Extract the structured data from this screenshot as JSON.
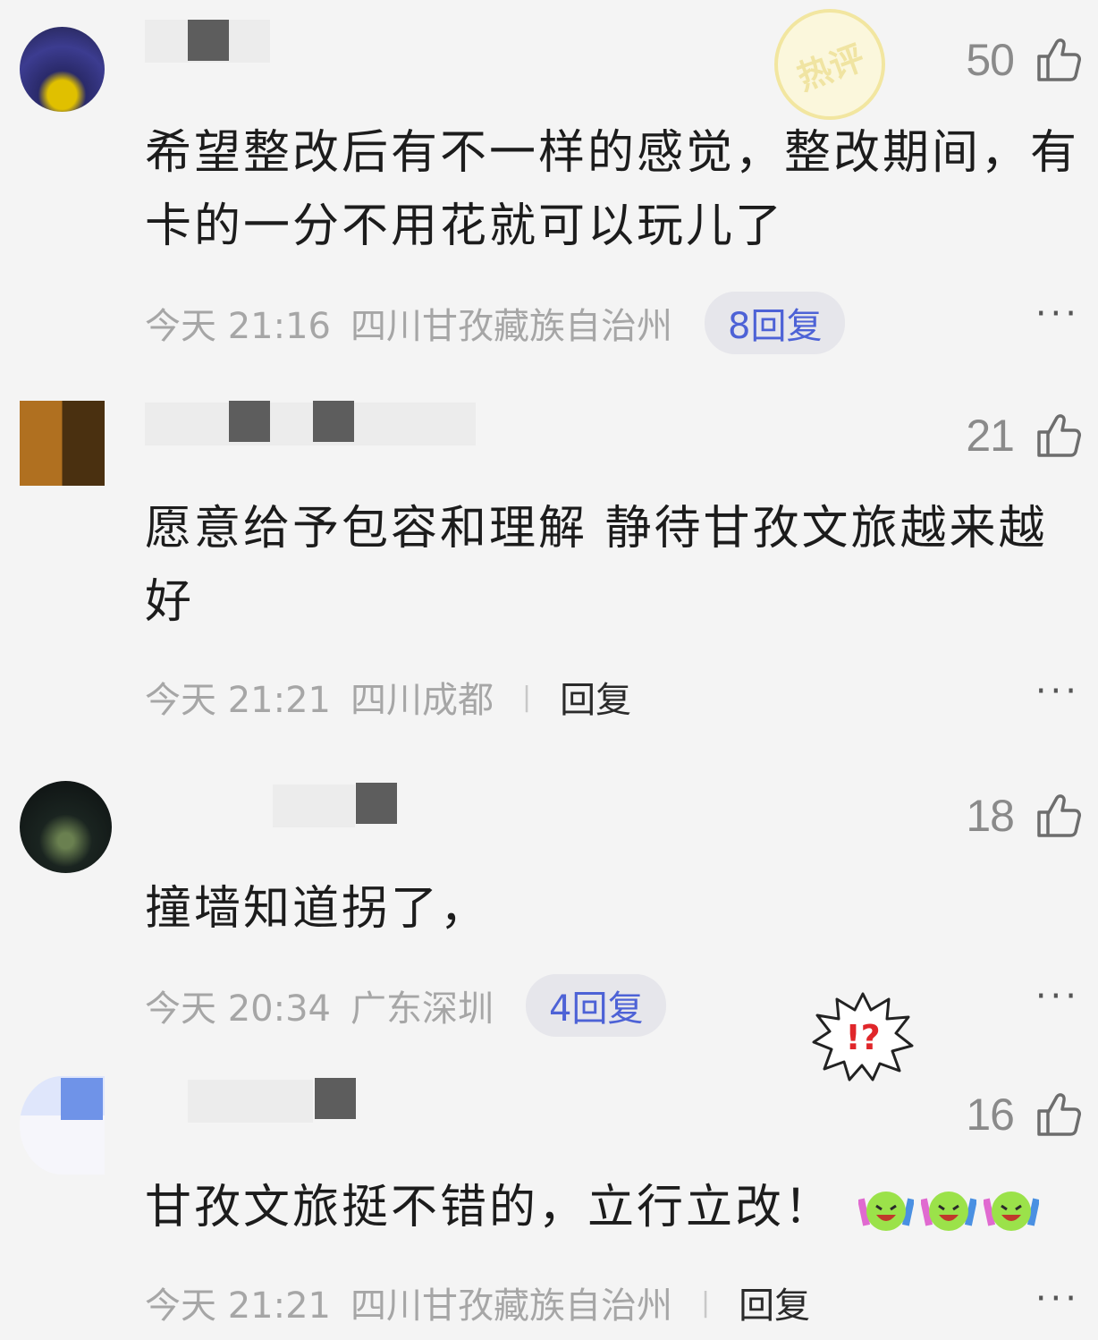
{
  "comments": [
    {
      "likes": "50",
      "text_lines": [
        "希望整改后有不一样的感觉，整改期间，有",
        "卡的一分不用花就可以玩儿了"
      ],
      "time": "今天 21:16",
      "location": "四川甘孜藏族自治州",
      "reply": "8回复",
      "badge": "热评",
      "more": "···"
    },
    {
      "likes": "21",
      "text_lines": [
        "愿意给予包容和理解 静待甘孜文旅越来越",
        "好"
      ],
      "time": "今天 21:21",
      "location": "四川成都",
      "reply": "回复",
      "more": "···"
    },
    {
      "likes": "18",
      "text_lines": [
        "撞墙知道拐了，"
      ],
      "time": "今天 20:34",
      "location": "广东深圳",
      "reply": "4回复",
      "more": "···"
    },
    {
      "likes": "16",
      "text_lines": [
        "甘孜文旅挺不错的，立行立改！"
      ],
      "time": "今天 21:21",
      "location": "四川甘孜藏族自治州",
      "reply": "回复",
      "more": "···"
    }
  ],
  "sticker": "!?",
  "separator": "|",
  "icons": {
    "like": "thumbs-up-icon",
    "more": "more-icon",
    "emoji": "laughing-emoji-icon"
  },
  "colors": {
    "reply_accent": "#4d62d6",
    "meta": "#a6a6a6",
    "like": "#8a8a8a"
  }
}
